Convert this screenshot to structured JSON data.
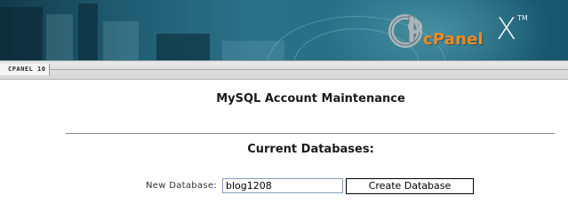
{
  "header": {
    "logo_text": "cPanel",
    "theme_mark": "X",
    "trademark": "TM"
  },
  "strip": {
    "version_label": "CPANEL 10"
  },
  "main": {
    "page_title": "MySQL Account Maintenance",
    "current_databases_heading": "Current Databases:",
    "new_database": {
      "label": "New Database:",
      "value": "blog1208",
      "button_label": "Create Database"
    }
  },
  "colors": {
    "banner_dark": "#123a4a",
    "banner_mid": "#2b7288",
    "logo_orange": "#f28a1e"
  },
  "icons": [
    "cpanel-logo-icon"
  ]
}
